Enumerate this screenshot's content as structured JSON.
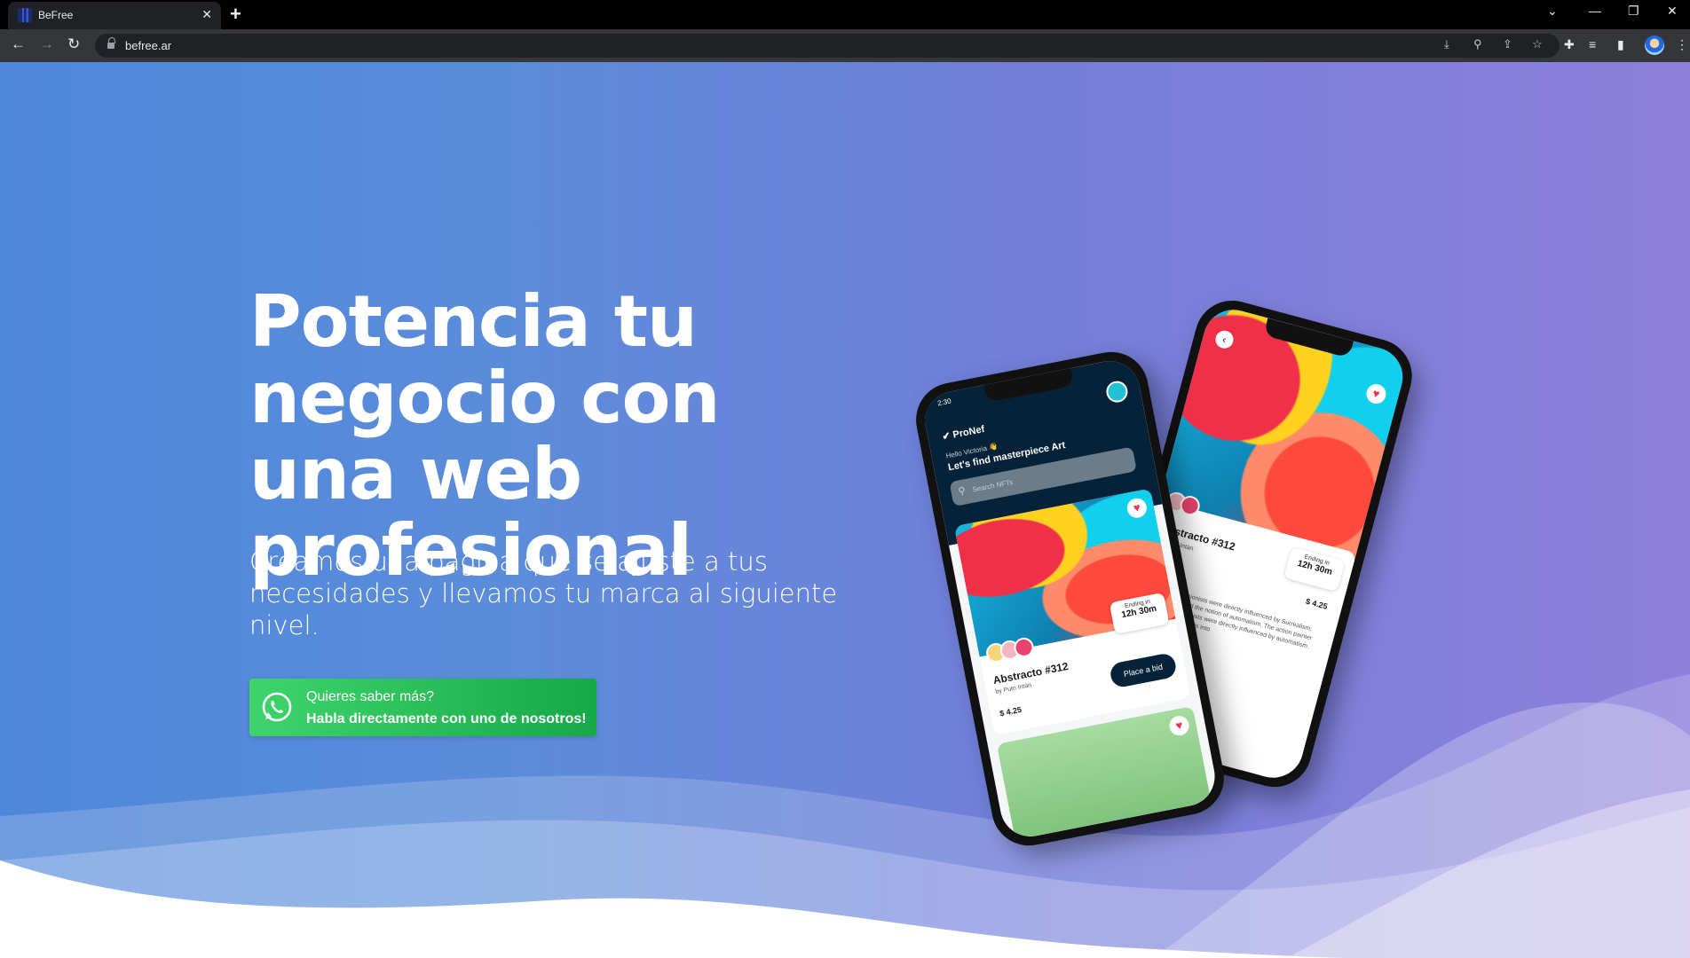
{
  "browser": {
    "tab_title": "BeFree",
    "url": "befree.ar"
  },
  "hero": {
    "headline": "Potencia tu negocio con una web profesional",
    "subtext": "Creamos una página que se ajuste a tus necesidades y llevamos tu marca al siguiente nivel.",
    "cta_line1": "Quieres saber más?",
    "cta_line2": "Habla directamente con uno de nosotros!"
  },
  "mockup": {
    "time": "2:30",
    "brand": "ProNef",
    "greeting": "Hello Victoria 👋",
    "tagline": "Let's find masterpiece Art",
    "search_placeholder": "Search NFTs",
    "card_title": "Abstracto #312",
    "card_author": "by Putri Intan",
    "price": "4.25",
    "ending_label": "Ending in",
    "ending_time": "12h 30m",
    "bid_button": "Place a bid",
    "description": "Abstract expressionists were directly influenced by Surrealism, which championed the notion of automatism. The action painter abstract expressionists were directly influenced by automatism. Pollock channeled this into",
    "bid_short": "bid"
  },
  "colors": {
    "hero_left": "#4f87d9",
    "hero_right": "#8f7fdc",
    "cta_green": "#25c05a",
    "app_dark": "#062238"
  }
}
